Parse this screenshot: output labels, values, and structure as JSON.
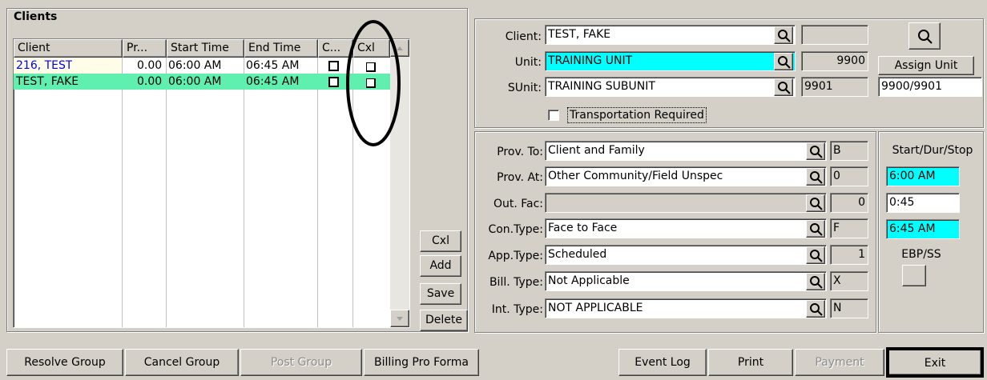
{
  "clients_panel": {
    "title": "Clients",
    "columns": [
      "Client",
      "Pr...",
      "Start Time",
      "End Time",
      "C...",
      "Cxl"
    ],
    "rows": [
      {
        "client": "216, TEST",
        "pr": "0.00",
        "start": "06:00 AM",
        "end": "06:45 AM"
      },
      {
        "client": "TEST, FAKE",
        "pr": "0.00",
        "start": "06:00 AM",
        "end": "06:45 AM"
      }
    ]
  },
  "list_buttons": {
    "cxl": "Cxl",
    "add": "Add",
    "save": "Save",
    "delete": "Delete"
  },
  "top_form": {
    "client_label": "Client:",
    "client_value": "TEST, FAKE",
    "client_code": "",
    "unit_label": "Unit:",
    "unit_value": "TRAINING UNIT",
    "unit_code": "9900",
    "sunit_label": "SUnit:",
    "sunit_value": "TRAINING SUBUNIT",
    "sunit_code": "9901",
    "assign_unit": "Assign Unit",
    "assign_value": "9900/9901",
    "transport_label": "Transportation Required"
  },
  "detail_form": {
    "prov_to": {
      "label": "Prov. To:",
      "value": "Client and Family",
      "code": "B"
    },
    "prov_at": {
      "label": "Prov. At:",
      "value": "Other Community/Field Unspec",
      "code": "0"
    },
    "out_fac": {
      "label": "Out. Fac:",
      "value": "",
      "code": "0"
    },
    "con_type": {
      "label": "Con.Type:",
      "value": "Face to Face",
      "code": "F"
    },
    "app_type": {
      "label": "App.Type:",
      "value": "Scheduled",
      "code": "1"
    },
    "bill_type": {
      "label": "Bill. Type:",
      "value": "Not Applicable",
      "code": "X"
    },
    "int_type": {
      "label": "Int. Type:",
      "value": "NOT APPLICABLE",
      "code": "N"
    }
  },
  "time_panel": {
    "title": "Start/Dur/Stop",
    "start": "6:00 AM",
    "duration": "0:45",
    "stop": "6:45 AM",
    "ebp_label": "EBP/SS"
  },
  "bottom_buttons": {
    "resolve_group": "Resolve Group",
    "cancel_group": "Cancel Group",
    "post_group": "Post Group",
    "billing_pro_forma": "Billing Pro Forma",
    "event_log": "Event Log",
    "print": "Print",
    "payment": "Payment",
    "exit": "Exit"
  },
  "colors": {
    "cyan": "#00ffff",
    "row_selected": "#5ff0b0",
    "row_yellow": "#fffde8",
    "link_blue": "#0000ff",
    "face": "#d4d0c8"
  },
  "icons": [
    "magnifier-icon",
    "scroll-up-arrow-icon",
    "scroll-down-arrow-icon",
    "checkbox-icon"
  ]
}
